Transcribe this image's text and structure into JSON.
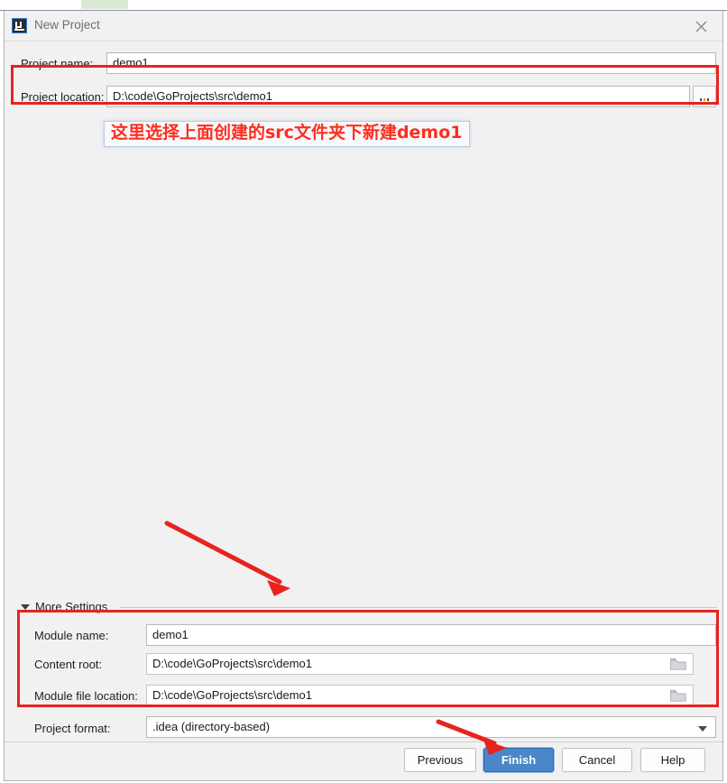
{
  "window": {
    "title": "New Project",
    "app_icon": "intellij-idea-icon",
    "close_icon": "close-icon"
  },
  "form": {
    "project_name": {
      "label": "Project name:",
      "value": "demo1"
    },
    "project_location": {
      "label": "Project location:",
      "value": "D:\\code\\GoProjects\\src\\demo1",
      "browse_icon": "ellipsis-icon"
    }
  },
  "annotation": {
    "text": "这里选择上面创建的src文件夹下新建demo1",
    "color": "#ff2d1f",
    "box_border": "#b9cbe4",
    "highlight_color": "#e8231f"
  },
  "more_settings": {
    "label": "More Settings",
    "expanded": true,
    "toggle_icon": "chevron-down-icon",
    "fields": [
      {
        "label": "Module name:",
        "value": "demo1",
        "icon": null
      },
      {
        "label": "Content root:",
        "value": "D:\\code\\GoProjects\\src\\demo1",
        "icon": "folder-icon"
      },
      {
        "label": "Module file location:",
        "value": "D:\\code\\GoProjects\\src\\demo1",
        "icon": "folder-icon"
      }
    ],
    "project_format": {
      "label": "Project format:",
      "value": ".idea (directory-based)",
      "dropdown_icon": "chevron-down-icon"
    }
  },
  "footer": {
    "buttons": [
      {
        "label": "Previous",
        "primary": false
      },
      {
        "label": "Finish",
        "primary": true
      },
      {
        "label": "Cancel",
        "primary": false
      },
      {
        "label": "Help",
        "primary": false
      }
    ]
  }
}
